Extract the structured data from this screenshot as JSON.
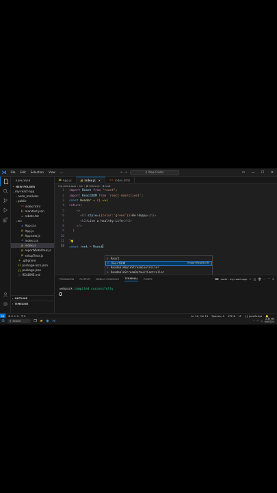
{
  "titlebar": {
    "menus": [
      "File",
      "Edit",
      "Selection",
      "View",
      "···"
    ],
    "search_text": "New Folder"
  },
  "explorer": {
    "header": "EXPLORER",
    "section": "NEW FOLDER",
    "tree": [
      {
        "label": "my-react-app",
        "depth": 0,
        "kind": "folder-open"
      },
      {
        "label": "node_modules",
        "depth": 1,
        "kind": "folder"
      },
      {
        "label": "public",
        "depth": 1,
        "kind": "folder-open"
      },
      {
        "label": "index.html",
        "depth": 2,
        "kind": "html"
      },
      {
        "label": "manifest.json",
        "depth": 2,
        "kind": "json"
      },
      {
        "label": "robots.txt",
        "depth": 2,
        "kind": "txt"
      },
      {
        "label": "src",
        "depth": 1,
        "kind": "folder-open"
      },
      {
        "label": "App.css",
        "depth": 2,
        "kind": "css"
      },
      {
        "label": "App.js",
        "depth": 2,
        "kind": "js"
      },
      {
        "label": "App.test.js",
        "depth": 2,
        "kind": "js"
      },
      {
        "label": "index.css",
        "depth": 2,
        "kind": "css"
      },
      {
        "label": "index.js",
        "depth": 2,
        "kind": "js",
        "selected": true
      },
      {
        "label": "reportWebVitals.js",
        "depth": 2,
        "kind": "js"
      },
      {
        "label": "setupTests.js",
        "depth": 2,
        "kind": "js"
      },
      {
        "label": ".gitignore",
        "depth": 1,
        "kind": "git"
      },
      {
        "label": "package-lock.json",
        "depth": 1,
        "kind": "json"
      },
      {
        "label": "package.json",
        "depth": 1,
        "kind": "json"
      },
      {
        "label": "README.md",
        "depth": 1,
        "kind": "md"
      }
    ],
    "outline": "OUTLINE",
    "timeline": "TIMELINE"
  },
  "tabs": [
    {
      "label": "App.js",
      "active": false
    },
    {
      "label": "index.js",
      "active": true
    },
    {
      "label": "index.html",
      "active": false
    }
  ],
  "breadcrumbs": [
    "my-react-app",
    "src",
    "index.js",
    "root"
  ],
  "code_lines": [
    "1",
    "2",
    "3",
    "4",
    "5",
    "6",
    "7",
    "8",
    "9",
    "10",
    "11",
    "12"
  ],
  "code": {
    "l1_kw": "import",
    "l1_id": " React ",
    "l1_from": "from",
    "l1_str": " \"react\"",
    "l1_end": ";",
    "l2_kw": "import",
    "l2_id": " ReactDOM ",
    "l2_from": "from",
    "l2_str": " 'react-dom/client'",
    "l2_end": ";",
    "l3_kw": "const",
    "l3_fn": " Header ",
    "l3_rest": "= () =>{",
    "l4": "return(",
    "l5": "<>",
    "l6_open": "<h1",
    "l6_attr": " style",
    "l6_eq": "=",
    "l6_obj": "{{color:'green'}}",
    "l6_gt": ">",
    "l6_text": "Be Happy",
    "l6_close": "</h1>",
    "l7_open": "<h2>",
    "l7_text": "Live a healthy Life",
    "l7_close": "</h2>",
    "l8": "</>",
    "l9": ")",
    "l11": "}",
    "l12_kw": "const",
    "l12_id": " root ",
    "l12_eq": "= ",
    "l12_typed": "React"
  },
  "suggestions": [
    {
      "label": "React",
      "detail": ""
    },
    {
      "label": "ReactDOM",
      "detail": "import ReactDOM",
      "selected": true
    },
    {
      "label": "ReadableByteStreamController",
      "detail": ""
    },
    {
      "label": "ReadableStreamDefaultController",
      "detail": ""
    },
    {
      "label": "RTCIceCandidate",
      "detail": ""
    },
    {
      "label": "RTCCertificate",
      "detail": ""
    },
    {
      "label": "SpeechRecognitionAlternative",
      "detail": ""
    },
    {
      "label": "RTCIceTransport",
      "detail": ""
    },
    {
      "label": "RTCDTMFToneChangeEvent",
      "detail": ""
    }
  ],
  "panel": {
    "tabs": [
      "PROBLEMS",
      "OUTPUT",
      "DEBUG CONSOLE",
      "TERMINAL",
      "PORTS"
    ],
    "active": "TERMINAL",
    "terminal_name": "node - my-react-app",
    "line1_a": "webpack ",
    "line1_b": "compiled successfully"
  },
  "status": {
    "errors": "⊗ 0 ⚠ 0",
    "ports": "⚲ 0",
    "position": "Ln 12, Col 19",
    "spaces": "Spaces: 4",
    "encoding": "UTF-8",
    "eol": "LF",
    "lang": "{} JavaScript"
  },
  "taskbar": {
    "search": "Search",
    "time": "2:39 PM",
    "date": "6/9/2024"
  }
}
